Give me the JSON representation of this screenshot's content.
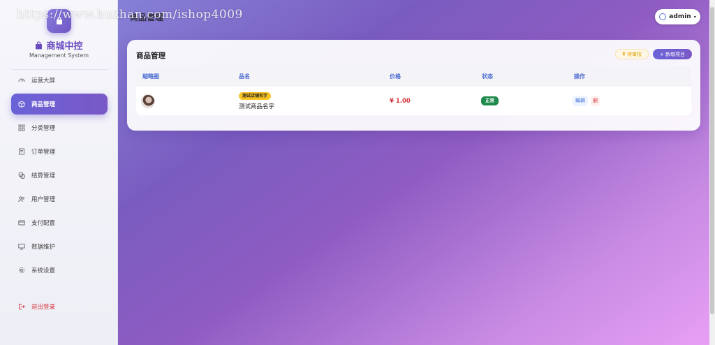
{
  "watermark": "https://www.huzhan.com/ishop4009",
  "header": {
    "title": "商品管理",
    "user_label": "admin"
  },
  "sidebar": {
    "brand_title": "商城中控",
    "brand_subtitle": "Management System",
    "items": [
      {
        "label": "运营大屏",
        "icon": "dashboard-icon"
      },
      {
        "label": "商品管理",
        "icon": "box-icon",
        "active": true
      },
      {
        "label": "分类管理",
        "icon": "grid-icon"
      },
      {
        "label": "订单管理",
        "icon": "document-icon"
      },
      {
        "label": "结算管理",
        "icon": "coins-icon"
      },
      {
        "label": "用户管理",
        "icon": "users-icon"
      },
      {
        "label": "支付配置",
        "icon": "credit-card-icon"
      },
      {
        "label": "数据维护",
        "icon": "monitor-icon"
      },
      {
        "label": "系统设置",
        "icon": "gear-icon"
      }
    ],
    "logout_label": "退出登录"
  },
  "card": {
    "title": "商品管理",
    "pending_label": "待审核",
    "add_label": "+ 新增项目"
  },
  "table": {
    "columns": [
      "缩略图",
      "品名",
      "价格",
      "状态",
      "操作"
    ],
    "rows": [
      {
        "shop_badge": "测试店铺名字",
        "name": "测试商品名字",
        "price": "¥ 1.00",
        "status": "正常",
        "edit_label": "编辑",
        "delete_label": "删"
      }
    ]
  },
  "colors": {
    "accent": "#6a63d8",
    "price": "#d6333a",
    "status_ok": "#1f8a4c",
    "shop_badge": "#f7c325"
  }
}
